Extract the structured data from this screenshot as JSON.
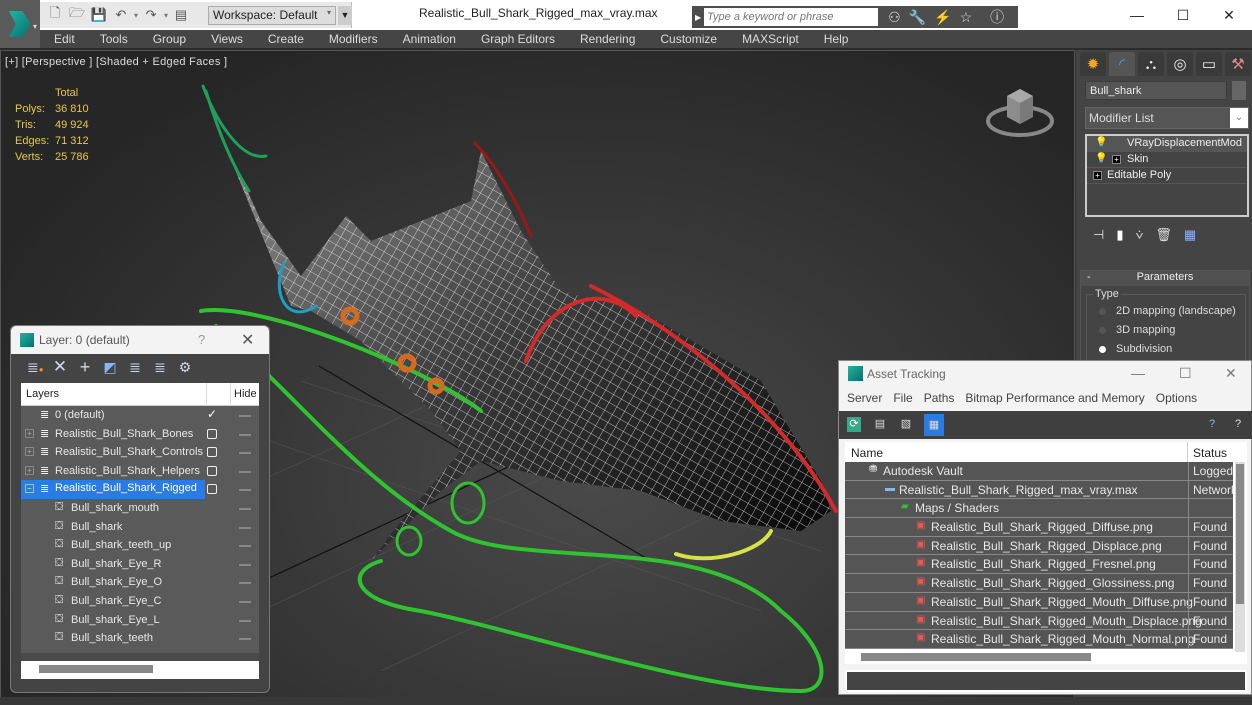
{
  "app": {
    "title": "Realistic_Bull_Shark_Rigged_max_vray.max",
    "workspace": "Workspace: Default",
    "search_placeholder": "Type a keyword or phrase",
    "window_controls": {
      "minimize": "—",
      "maximize": "☐",
      "close": "✕"
    }
  },
  "quick_access": [
    "new-icon",
    "open-icon",
    "save-icon",
    "undo-icon",
    "redo-icon",
    "project-icon"
  ],
  "menu": [
    "Edit",
    "Tools",
    "Group",
    "Views",
    "Create",
    "Modifiers",
    "Animation",
    "Graph Editors",
    "Rendering",
    "Customize",
    "MAXScript",
    "Help"
  ],
  "viewport": {
    "label": "[+] [Perspective ] [Shaded + Edged Faces ]",
    "stats": {
      "header": "Total",
      "rows": [
        {
          "label": "Polys:",
          "value": "36 810"
        },
        {
          "label": "Tris:",
          "value": "49 924"
        },
        {
          "label": "Edges:",
          "value": "71 312"
        },
        {
          "label": "Verts:",
          "value": "25 786"
        }
      ]
    }
  },
  "command_panel": {
    "tabs": [
      "create-icon",
      "modify-icon",
      "hierarchy-icon",
      "motion-icon",
      "display-icon",
      "utilities-icon"
    ],
    "object_name": "Bull_shark",
    "modifier_list": "Modifier List",
    "stack": [
      {
        "label": "VRayDisplacementMod",
        "bulb": true,
        "box": false
      },
      {
        "label": "Skin",
        "bulb": true,
        "box": true
      },
      {
        "label": "Editable Poly",
        "bulb": false,
        "box": true
      }
    ],
    "parameters": {
      "title": "Parameters",
      "collapse": "-",
      "type_label": "Type",
      "options": [
        {
          "label": "2D mapping (landscape)",
          "selected": false
        },
        {
          "label": "3D mapping",
          "selected": false
        },
        {
          "label": "Subdivision",
          "selected": true
        }
      ]
    }
  },
  "layer_dialog": {
    "title": "Layer: 0 (default)",
    "help": "?",
    "close": "✕",
    "columns": {
      "layers": "Layers",
      "hide": "Hide"
    },
    "rows": [
      {
        "name": "0 (default)",
        "type": "layer",
        "expand": false,
        "current": true
      },
      {
        "name": "Realistic_Bull_Shark_Bones",
        "type": "layer",
        "expand": true,
        "current": false
      },
      {
        "name": "Realistic_Bull_Shark_Controls",
        "type": "layer",
        "expand": true,
        "current": false
      },
      {
        "name": "Realistic_Bull_Shark_Helpers",
        "type": "layer",
        "expand": true,
        "current": false
      },
      {
        "name": "Realistic_Bull_Shark_Rigged",
        "type": "layer",
        "expand": true,
        "current": false,
        "selected": true
      },
      {
        "name": "Bull_shark_mouth",
        "type": "object"
      },
      {
        "name": "Bull_shark",
        "type": "object"
      },
      {
        "name": "Bull_shark_teeth_up",
        "type": "object"
      },
      {
        "name": "Bull_shark_Eye_R",
        "type": "object"
      },
      {
        "name": "Bull_shark_Eye_O",
        "type": "object"
      },
      {
        "name": "Bull_shark_Eye_C",
        "type": "object"
      },
      {
        "name": "Bull_shark_Eye_L",
        "type": "object"
      },
      {
        "name": "Bull_shark_teeth",
        "type": "object"
      }
    ]
  },
  "asset_dialog": {
    "title": "Asset Tracking",
    "menu": [
      "Server",
      "File",
      "Paths",
      "Bitmap Performance and Memory",
      "Options"
    ],
    "columns": {
      "name": "Name",
      "status": "Status"
    },
    "rows": [
      {
        "name": "Autodesk Vault",
        "status": "Logged",
        "level": 0,
        "icon": "vault-icon"
      },
      {
        "name": "Realistic_Bull_Shark_Rigged_max_vray.max",
        "status": "Network",
        "level": 1,
        "icon": "max-file-icon"
      },
      {
        "name": "Maps / Shaders",
        "status": "",
        "level": 2,
        "icon": "maps-folder-icon"
      },
      {
        "name": "Realistic_Bull_Shark_Rigged_Diffuse.png",
        "status": "Found",
        "level": 3,
        "icon": "png-icon"
      },
      {
        "name": "Realistic_Bull_Shark_Rigged_Displace.png",
        "status": "Found",
        "level": 3,
        "icon": "png-icon"
      },
      {
        "name": "Realistic_Bull_Shark_Rigged_Fresnel.png",
        "status": "Found",
        "level": 3,
        "icon": "png-icon"
      },
      {
        "name": "Realistic_Bull_Shark_Rigged_Glossiness.png",
        "status": "Found",
        "level": 3,
        "icon": "png-icon"
      },
      {
        "name": "Realistic_Bull_Shark_Rigged_Mouth_Diffuse.png",
        "status": "Found",
        "level": 3,
        "icon": "png-icon"
      },
      {
        "name": "Realistic_Bull_Shark_Rigged_Mouth_Displace.png",
        "status": "Found",
        "level": 3,
        "icon": "png-icon"
      },
      {
        "name": "Realistic_Bull_Shark_Rigged_Mouth_Normal.png",
        "status": "Found",
        "level": 3,
        "icon": "png-icon"
      }
    ]
  },
  "colors": {
    "accent": "#2a7be4",
    "stats": "#e6c84a",
    "rig_green": "#2fc42f",
    "rig_red": "#d42a2a",
    "rig_yellow": "#d8e04a",
    "rig_orange": "#d86a1e",
    "rig_blue": "#1aa0c8"
  }
}
